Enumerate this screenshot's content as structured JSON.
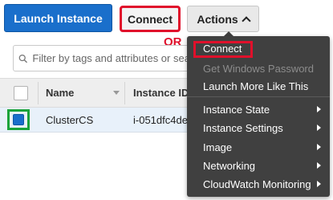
{
  "toolbar": {
    "launch_label": "Launch Instance",
    "connect_label": "Connect",
    "actions_label": "Actions",
    "or_label": "OR"
  },
  "search": {
    "placeholder": "Filter by tags and attributes or search"
  },
  "table": {
    "columns": [
      "Name",
      "Instance ID"
    ],
    "rows": [
      {
        "name": "ClusterCS",
        "instance_id": "i-051dfc4de"
      }
    ]
  },
  "actions_menu": {
    "items": [
      {
        "label": "Connect",
        "disabled": false,
        "submenu": false
      },
      {
        "label": "Get Windows Password",
        "disabled": true,
        "submenu": false
      },
      {
        "label": "Launch More Like This",
        "disabled": false,
        "submenu": false
      },
      {
        "label": "Instance State",
        "disabled": false,
        "submenu": true
      },
      {
        "label": "Instance Settings",
        "disabled": false,
        "submenu": true
      },
      {
        "label": "Image",
        "disabled": false,
        "submenu": true
      },
      {
        "label": "Networking",
        "disabled": false,
        "submenu": true
      },
      {
        "label": "CloudWatch Monitoring",
        "disabled": false,
        "submenu": true
      }
    ]
  },
  "colors": {
    "primary": "#1a6fcb",
    "highlight_red": "#e0102b",
    "highlight_green": "#1aa33a",
    "menu_bg": "#404040"
  }
}
